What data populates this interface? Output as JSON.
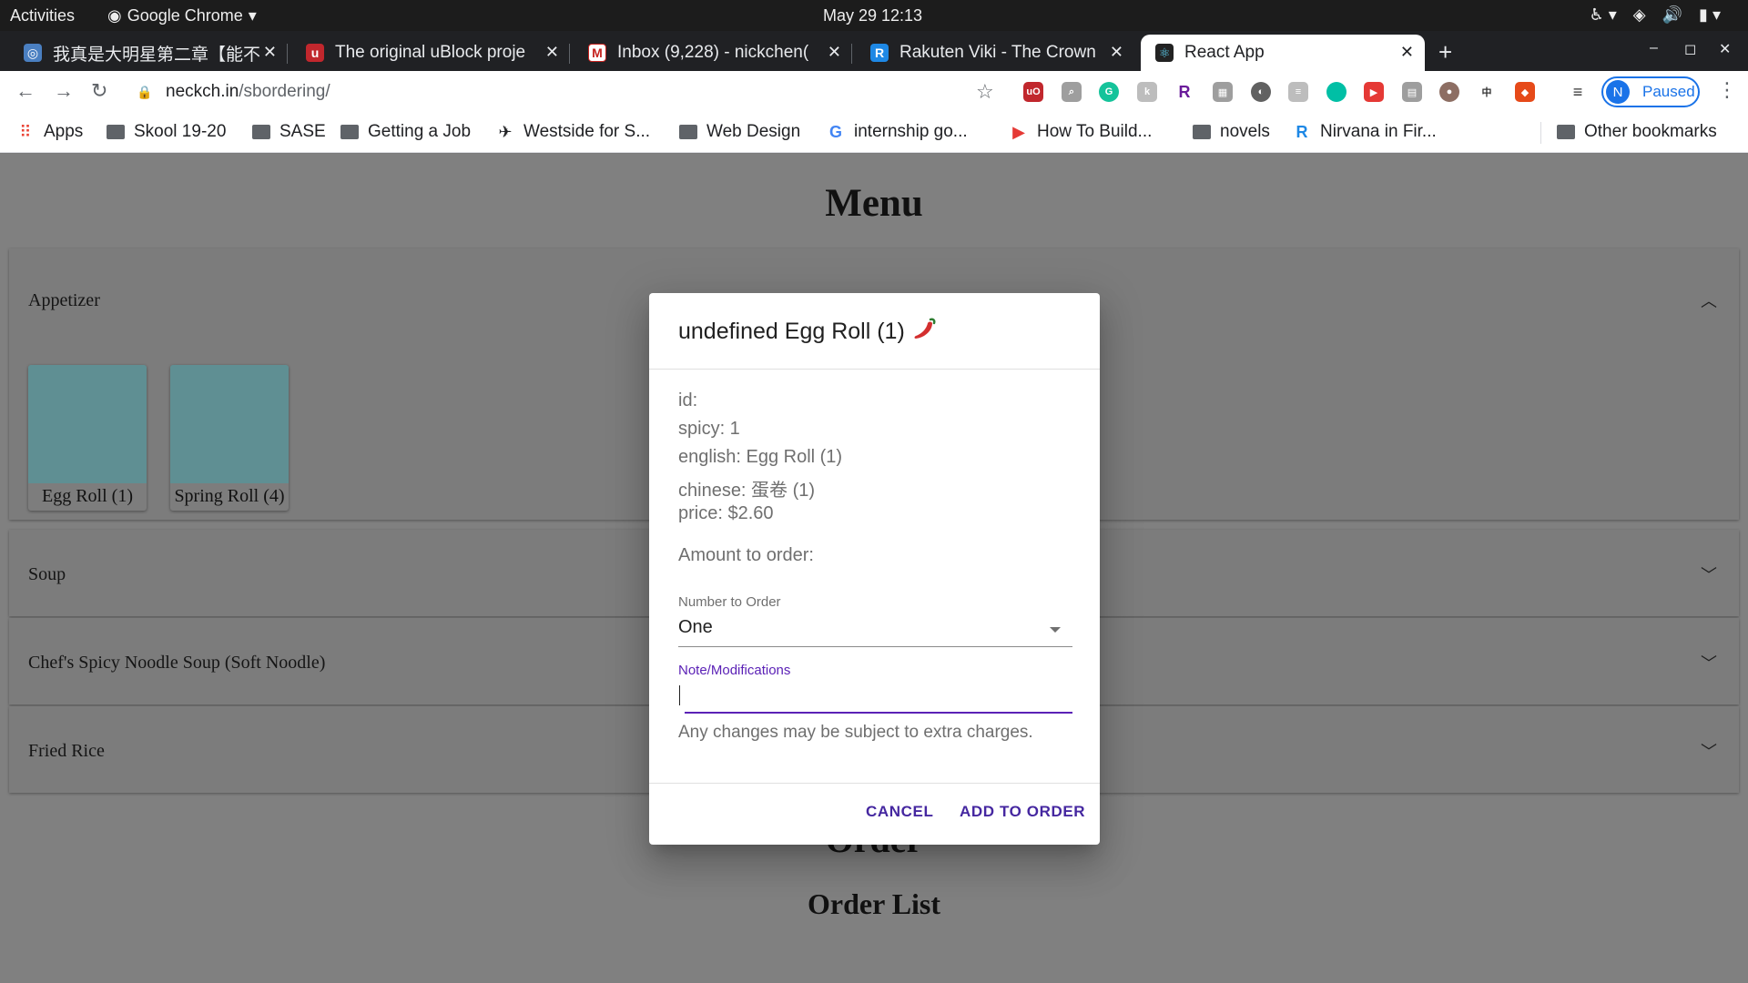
{
  "gnome": {
    "activities": "Activities",
    "app_name": "Google Chrome",
    "clock": "May 29  12:13"
  },
  "tabs": [
    {
      "title": "我真是大明星第二章【能不",
      "favicon": "globe-icon",
      "color": "#4a7fc1"
    },
    {
      "title": "The original uBlock proje",
      "favicon": "ublock-icon",
      "color": "#c1272d"
    },
    {
      "title": "Inbox (9,228) - nickchen(",
      "favicon": "gmail-icon",
      "color": "#c5221f"
    },
    {
      "title": "Rakuten Viki - The Crown",
      "favicon": "viki-icon",
      "color": "#1e88e5"
    },
    {
      "title": "React App",
      "favicon": "react-icon",
      "color": "#61dafb"
    }
  ],
  "toolbar": {
    "url_host": "neckch.in",
    "url_path": "/sbordering/",
    "profile_initial": "N",
    "profile_label": "Paused"
  },
  "bookmarks": [
    {
      "label": "Apps",
      "icon": "apps-grid-icon"
    },
    {
      "label": "Skool 19-20",
      "icon": "folder-icon"
    },
    {
      "label": "SASE",
      "icon": "folder-icon"
    },
    {
      "label": "Getting a Job",
      "icon": "folder-icon"
    },
    {
      "label": "Westside for S...",
      "icon": "runner-icon"
    },
    {
      "label": "Web Design",
      "icon": "folder-icon"
    },
    {
      "label": "internship go...",
      "icon": "google-icon"
    },
    {
      "label": "How To Build...",
      "icon": "youtube-icon"
    },
    {
      "label": "novels",
      "icon": "folder-icon"
    },
    {
      "label": "Nirvana in Fir...",
      "icon": "rakuten-icon"
    },
    {
      "label": "Other bookmarks",
      "icon": "folder-icon"
    }
  ],
  "page": {
    "menu_title": "Menu",
    "sections": [
      {
        "title": "Appetizer",
        "items": [
          "Egg Roll (1)",
          "Spring Roll (4)"
        ]
      },
      {
        "title": "Soup"
      },
      {
        "title": "Chef's Spicy Noodle Soup (Soft Noodle)"
      },
      {
        "title": "Fried Rice"
      }
    ],
    "order_heading": "Order",
    "order_list_heading": "Order List"
  },
  "dialog": {
    "title": "undefined Egg Roll (1)",
    "info": [
      "id:",
      "spicy: 1",
      "english: Egg Roll (1)",
      "chinese: 蛋卷 (1)",
      "price: $2.60"
    ],
    "amount_label": "Amount to order:",
    "number_label": "Number to Order",
    "number_value": "One",
    "note_label": "Note/Modifications",
    "note_value": "",
    "helper_text": "Any changes may be subject to extra charges.",
    "cancel_label": "CANCEL",
    "add_label": "ADD TO ORDER"
  }
}
